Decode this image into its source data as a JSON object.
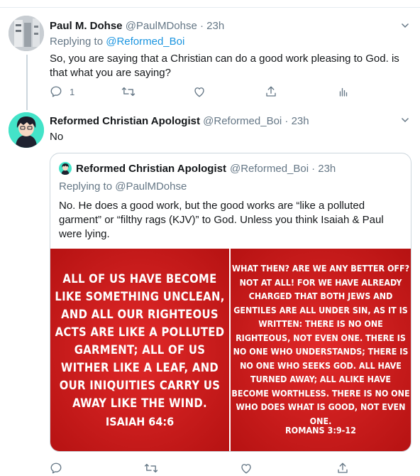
{
  "tweet1": {
    "name": "Paul M. Dohse",
    "handle": "@PaulMDohse",
    "time": "· 23h",
    "replying_prefix": "Replying to ",
    "replying_to": "@Reformed_Boi",
    "text": "So, you are saying that a Christian can do a good work pleasing to God. is that what you are saying?",
    "reply_count": "1"
  },
  "tweet2": {
    "name": "Reformed Christian Apologist",
    "handle": "@Reformed_Boi",
    "time": "· 23h",
    "text": "No"
  },
  "quote": {
    "name": "Reformed Christian Apologist",
    "handle": "@Reformed_Boi",
    "time": "· 23h",
    "replying": "Replying to @PaulMDohse",
    "text": "No. He does a good work, but the good works are “like a polluted garment” or “filthy rags (KJV)” to God. Unless you think Isaiah & Paul were lying.",
    "image_left_text": "All of us have become like something unclean, and all our righteous acts are like a polluted garment; all of us wither like a leaf, and our iniquities carry us away like the wind.",
    "image_left_ref": "Isaiah 64:6",
    "image_right_text": "What then? Are we any better off? Not at all! For we have already charged that both Jews and Gentiles are all under sin, as it is written: There is no one righteous, not even one. There is no one who understands; there is no one who seeks God. All have turned away; all alike have become worthless. There is no one who does what is good, not even one.",
    "image_right_ref": "Romans 3:9-12"
  },
  "icons": {
    "reply": "reply-icon",
    "retweet": "retweet-icon",
    "like": "heart-icon",
    "share": "share-icon",
    "analytics": "analytics-icon",
    "more": "chevron-down-icon"
  },
  "colors": {
    "link": "#1b95e0",
    "secondary_text": "#657786",
    "image_red": "#d71c1c"
  }
}
